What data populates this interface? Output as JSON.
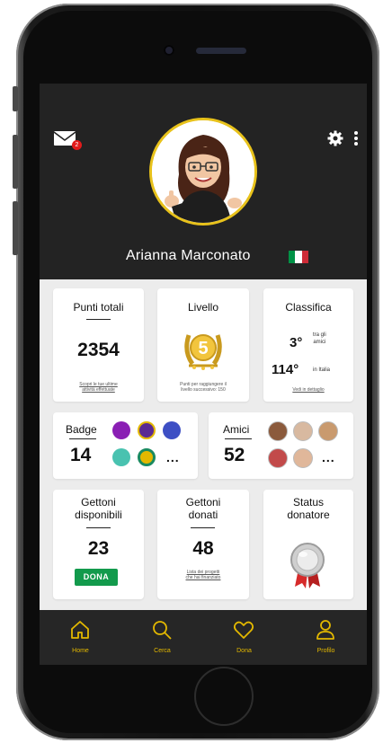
{
  "profile": {
    "name": "Arianna Marconato",
    "flag_colors": [
      "#009246",
      "#ffffff",
      "#ce2b37"
    ],
    "mail_badge": "2"
  },
  "cards": {
    "punti": {
      "title": "Punti totali",
      "value": "2354",
      "note": "Scopri le tue ultime \nattività effettuate"
    },
    "livello": {
      "title": "Livello",
      "level": "5",
      "note": "Punti per raggiungere il \nlivello successivo: 150"
    },
    "classifica": {
      "title": "Classifica",
      "friends_rank": "3°",
      "friends_label_1": "tra gli",
      "friends_label_2": "amici",
      "italy_rank": "114°",
      "italy_label": "in Italia",
      "link": "Vedi in dettaglio"
    },
    "badge": {
      "title": "Badge",
      "value": "14",
      "more": "..."
    },
    "amici": {
      "title": "Amici",
      "value": "52",
      "more": "..."
    },
    "gettoni_disp": {
      "title_1": "Gettoni",
      "title_2": "disponibili",
      "value": "23",
      "button": "DONA"
    },
    "gettoni_don": {
      "title_1": "Gettoni",
      "title_2": "donati",
      "value": "48",
      "note": "Lista dei progetti \nche hai finanziato"
    },
    "status": {
      "title_1": "Status",
      "title_2": "donatore"
    }
  },
  "tabs": [
    {
      "label": "Home",
      "icon": "home-icon"
    },
    {
      "label": "Cerca",
      "icon": "search-icon"
    },
    {
      "label": "Dona",
      "icon": "heart-icon"
    },
    {
      "label": "Profilo",
      "icon": "user-icon"
    }
  ],
  "colors": {
    "accent": "#e3b800",
    "dona_green": "#129a4c",
    "dark": "#232323"
  }
}
